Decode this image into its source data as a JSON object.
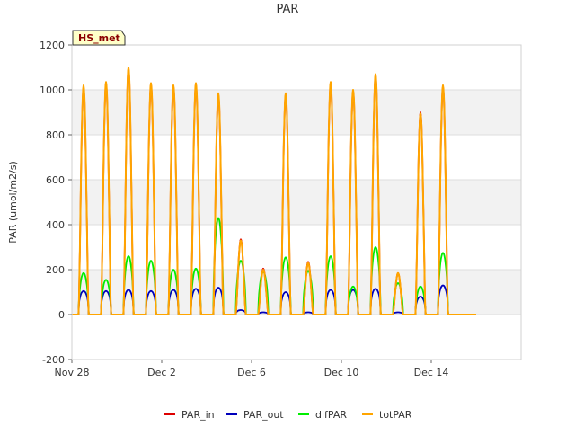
{
  "chart_data": {
    "type": "line",
    "title": "PAR",
    "ylabel": "PAR (umol/m2/s)",
    "xlabel": "",
    "station_tag": "HS_met",
    "ylim": [
      -200,
      1200
    ],
    "xlim": [
      "2022-11-28",
      "2022-12-18"
    ],
    "y_ticks": [
      -200,
      0,
      200,
      400,
      600,
      800,
      1000,
      1200
    ],
    "x_ticks": [
      {
        "date": "2022-11-28",
        "label": "Nov 28"
      },
      {
        "date": "2022-12-02",
        "label": "Dec 2"
      },
      {
        "date": "2022-12-06",
        "label": "Dec 6"
      },
      {
        "date": "2022-12-10",
        "label": "Dec 10"
      },
      {
        "date": "2022-12-14",
        "label": "Dec 14"
      }
    ],
    "grid": true,
    "legend_position": "bottom",
    "start": "2022-11-28T00:00",
    "end": "2022-12-16T00:00",
    "day_peaks": [
      {
        "date": "2022-11-28",
        "totPAR": 1020,
        "difPAR": 185,
        "PAR_out": 105,
        "PAR_in": 1010
      },
      {
        "date": "2022-11-29",
        "totPAR": 1035,
        "difPAR": 155,
        "PAR_out": 105,
        "PAR_in": 1030
      },
      {
        "date": "2022-11-30",
        "totPAR": 1100,
        "difPAR": 260,
        "PAR_out": 110,
        "PAR_in": 1095
      },
      {
        "date": "2022-12-01",
        "totPAR": 1030,
        "difPAR": 240,
        "PAR_out": 105,
        "PAR_in": 1025
      },
      {
        "date": "2022-12-02",
        "totPAR": 1020,
        "difPAR": 200,
        "PAR_out": 110,
        "PAR_in": 1015
      },
      {
        "date": "2022-12-03",
        "totPAR": 1030,
        "difPAR": 205,
        "PAR_out": 115,
        "PAR_in": 1025
      },
      {
        "date": "2022-12-04",
        "totPAR": 985,
        "difPAR": 430,
        "PAR_out": 120,
        "PAR_in": 980
      },
      {
        "date": "2022-12-05",
        "totPAR": 330,
        "difPAR": 240,
        "PAR_out": 20,
        "PAR_in": 335
      },
      {
        "date": "2022-12-06",
        "totPAR": 200,
        "difPAR": 190,
        "PAR_out": 10,
        "PAR_in": 205
      },
      {
        "date": "2022-12-07",
        "totPAR": 985,
        "difPAR": 255,
        "PAR_out": 100,
        "PAR_in": 980
      },
      {
        "date": "2022-12-08",
        "totPAR": 230,
        "difPAR": 195,
        "PAR_out": 10,
        "PAR_in": 235
      },
      {
        "date": "2022-12-09",
        "totPAR": 1035,
        "difPAR": 260,
        "PAR_out": 110,
        "PAR_in": 1030
      },
      {
        "date": "2022-12-10",
        "totPAR": 1000,
        "difPAR": 125,
        "PAR_out": 110,
        "PAR_in": 995
      },
      {
        "date": "2022-12-11",
        "totPAR": 1070,
        "difPAR": 300,
        "PAR_out": 115,
        "PAR_in": 1065
      },
      {
        "date": "2022-12-12",
        "totPAR": 185,
        "difPAR": 140,
        "PAR_out": 10,
        "PAR_in": 185
      },
      {
        "date": "2022-12-13",
        "totPAR": 895,
        "difPAR": 125,
        "PAR_out": 80,
        "PAR_in": 900
      },
      {
        "date": "2022-12-14",
        "totPAR": 1020,
        "difPAR": 275,
        "PAR_out": 130,
        "PAR_in": 1015
      }
    ],
    "series": [
      {
        "name": "PAR_in",
        "color": "#dd0000"
      },
      {
        "name": "PAR_out",
        "color": "#0000bb"
      },
      {
        "name": "difPAR",
        "color": "#00ee00"
      },
      {
        "name": "totPAR",
        "color": "#ffa500"
      }
    ]
  }
}
